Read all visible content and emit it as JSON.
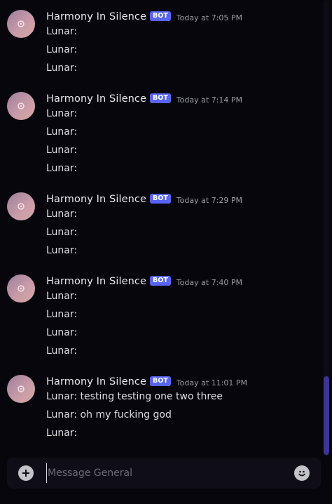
{
  "chat": {
    "groups": [
      {
        "username": "Harmony In Silence",
        "badge": "BOT",
        "timestamp": "Today at 7:05 PM",
        "lines": [
          "Lunar:",
          "Lunar:",
          "Lunar:"
        ]
      },
      {
        "username": "Harmony In Silence",
        "badge": "BOT",
        "timestamp": "Today at 7:14 PM",
        "lines": [
          "Lunar:",
          "Lunar:",
          "Lunar:",
          "Lunar:"
        ]
      },
      {
        "username": "Harmony In Silence",
        "badge": "BOT",
        "timestamp": "Today at 7:29 PM",
        "lines": [
          "Lunar:",
          "Lunar:",
          "Lunar:"
        ]
      },
      {
        "username": "Harmony In Silence",
        "badge": "BOT",
        "timestamp": "Today at 7:40 PM",
        "lines": [
          "Lunar:",
          "Lunar:",
          "Lunar:",
          "Lunar:"
        ]
      },
      {
        "username": "Harmony In Silence",
        "badge": "BOT",
        "timestamp": "Today at 11:01 PM",
        "lines": [
          "Lunar: testing testing one two three",
          "Lunar: oh my fucking god",
          "Lunar:"
        ]
      }
    ]
  },
  "composer": {
    "placeholder": "Message General",
    "add_icon": "plus-circle-icon",
    "emoji_icon": "smiley-icon"
  },
  "colors": {
    "background": "#07060c",
    "bot_badge": "#5865f2",
    "scroll_thumb": "#3a3596"
  }
}
